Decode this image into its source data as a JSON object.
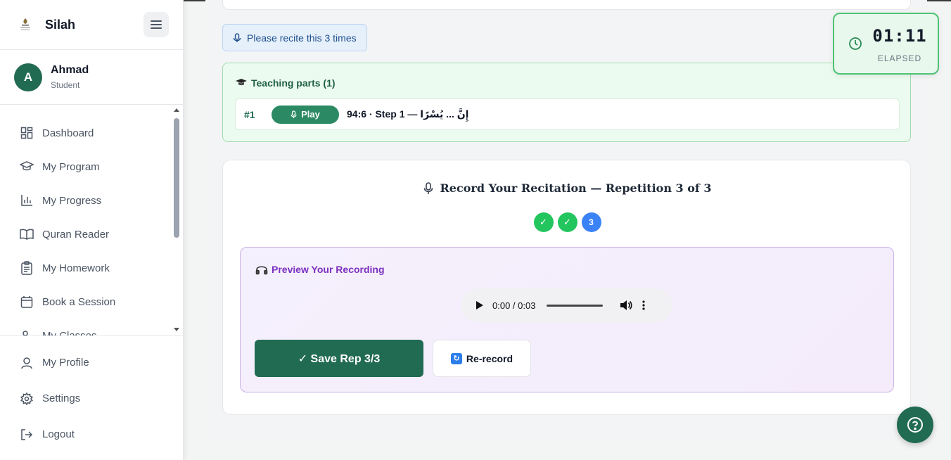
{
  "brand": {
    "name": "Silah",
    "logo_text": "SILAH"
  },
  "user": {
    "initial": "A",
    "name": "Ahmad",
    "role": "Student"
  },
  "nav": {
    "items": [
      {
        "label": "Dashboard",
        "icon": "dashboard-icon"
      },
      {
        "label": "My Program",
        "icon": "graduation-cap-icon"
      },
      {
        "label": "My Progress",
        "icon": "bar-chart-icon"
      },
      {
        "label": "Quran Reader",
        "icon": "book-open-icon"
      },
      {
        "label": "My Homework",
        "icon": "clipboard-icon"
      },
      {
        "label": "Book a Session",
        "icon": "calendar-icon"
      },
      {
        "label": "My Classes",
        "icon": "users-icon"
      }
    ],
    "bottom": [
      {
        "label": "My Profile",
        "icon": "user-icon"
      },
      {
        "label": "Settings",
        "icon": "gear-icon"
      },
      {
        "label": "Logout",
        "icon": "logout-icon"
      }
    ]
  },
  "recite_notice": "Please recite this 3 times",
  "teaching": {
    "title": "Teaching parts (1)",
    "parts": [
      {
        "num": "#1",
        "play_label": "Play",
        "text": "94:6 · Step 1 — إِنَّ ... يُسْرًا"
      }
    ]
  },
  "record": {
    "title": "Record Your Recitation — Repetition 3 of 3",
    "reps": [
      {
        "label": "✓",
        "state": "done"
      },
      {
        "label": "✓",
        "state": "done"
      },
      {
        "label": "3",
        "state": "current"
      }
    ],
    "preview_title": "Preview Your Recording",
    "audio_time": "0:00 / 0:03",
    "save_label": "✓ Save Rep 3/3",
    "rerecord_label": "Re-record"
  },
  "timer": {
    "value": "01:11",
    "label": "ELAPSED"
  },
  "colors": {
    "brand_green": "#226b53",
    "done": "#22c55e",
    "current": "#3b82f6",
    "preview_accent": "#7b2fbf"
  }
}
